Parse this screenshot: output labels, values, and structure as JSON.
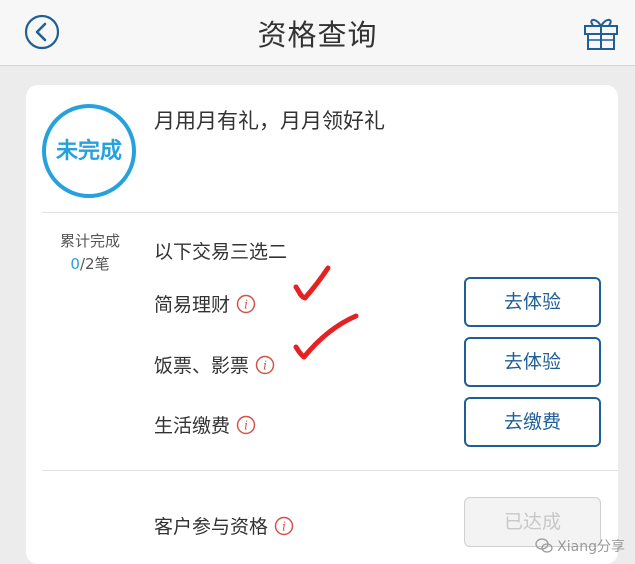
{
  "header": {
    "title": "资格查询",
    "back_icon": "back-arrow-icon",
    "gift_icon": "gift-icon"
  },
  "card": {
    "status": "未完成",
    "promo": "月用月有礼，月月领好礼",
    "progress_label": "累计完成",
    "progress_done": "0",
    "progress_total": "/2笔",
    "rule": "以下交易三选二",
    "items": [
      {
        "label": "简易理财",
        "button": "去体验"
      },
      {
        "label": "饭票、影票",
        "button": "去体验"
      },
      {
        "label": "生活缴费",
        "button": "去缴费"
      }
    ],
    "eligibility": {
      "label": "客户参与资格",
      "button": "已达成"
    }
  },
  "colors": {
    "accent": "#27a1dd",
    "button_border": "#1f5f96",
    "info_icon": "#d2534b",
    "annotation": "#e52222"
  },
  "watermark": "Xiang分享"
}
